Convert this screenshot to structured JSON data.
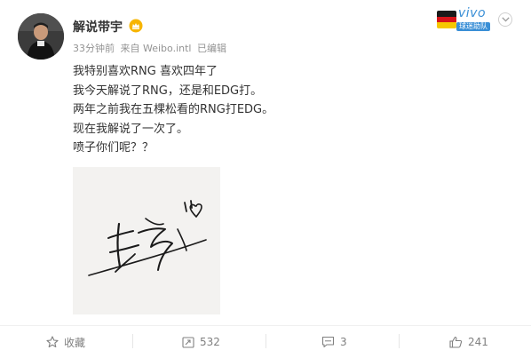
{
  "post": {
    "username": "解说带宇",
    "time": "33分钟前",
    "source": "来自 Weibo.intl",
    "edited": "已编辑",
    "lines": [
      "我特别喜欢RNG 喜欢四年了",
      "我今天解说了RNG，还是和EDG打。",
      "两年之前我在五棵松看的RNG打EDG。",
      "现在我解说了一次了。",
      "喷子你们呢？？"
    ]
  },
  "brand_badge": {
    "word": "vivo",
    "subtitle": "球迷助队"
  },
  "actions": {
    "favorite": "收藏",
    "repost": "532",
    "comment": "3",
    "like": "241"
  },
  "colors": {
    "accent": "#3a8fd6",
    "meta_text": "#939393",
    "action_text": "#808080",
    "vip_badge": "#f7b500"
  },
  "icons": [
    "vip-crown-icon",
    "chevron-down-icon",
    "star-icon",
    "repost-icon",
    "comment-icon",
    "thumbs-up-icon",
    "germany-flag-icon"
  ]
}
